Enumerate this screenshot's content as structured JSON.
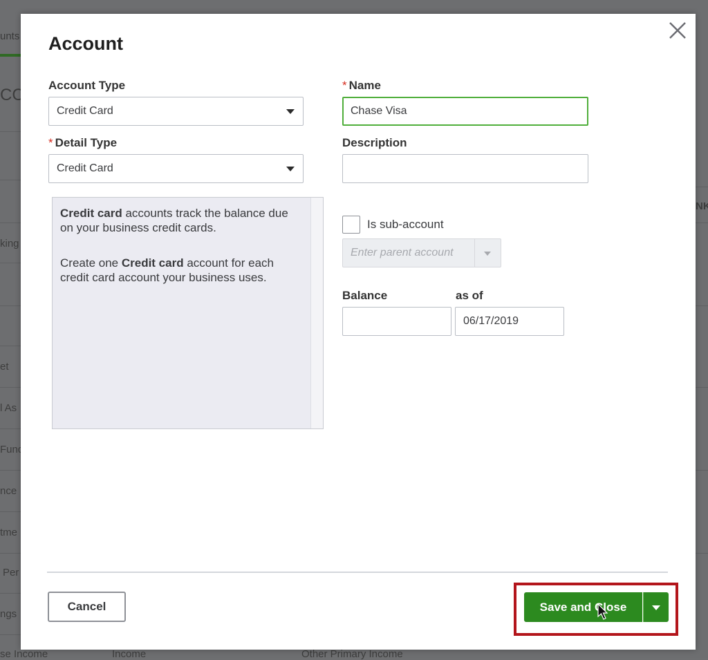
{
  "background": {
    "tab_fragment": "unts",
    "heading_fragment": "CC",
    "row_fragments": [
      "king",
      "et",
      "l As",
      "Fund",
      "nce",
      "tme",
      "Per",
      "ngs"
    ],
    "right_fragment": "NK",
    "bottom_row": [
      "se Income",
      "Income",
      "Other Primary Income"
    ]
  },
  "modal": {
    "title": "Account",
    "close_icon": "close-icon",
    "account_type": {
      "label": "Account Type",
      "value": "Credit Card"
    },
    "name": {
      "required_mark": "*",
      "label": "Name",
      "value": "Chase Visa"
    },
    "detail_type": {
      "required_mark": "*",
      "label": "Detail Type",
      "value": "Credit Card"
    },
    "description": {
      "label": "Description",
      "value": ""
    },
    "info": {
      "p1_bold": "Credit card",
      "p1_rest": " accounts track the balance due on your business credit cards.",
      "p2_start": "Create one ",
      "p2_bold": "Credit card",
      "p2_rest": " account for each credit card account your business uses."
    },
    "sub_account": {
      "label": "Is sub-account",
      "checked": false,
      "parent_placeholder": "Enter parent account"
    },
    "balance": {
      "label": "Balance",
      "value": ""
    },
    "as_of": {
      "label": "as of",
      "value": "06/17/2019"
    },
    "footer": {
      "cancel_label": "Cancel",
      "save_label": "Save and Close"
    }
  },
  "colors": {
    "accent_green": "#2c8a1f",
    "focus_green": "#4fae3a",
    "required_red": "#d52b1e",
    "highlight_red": "#b3151b"
  }
}
